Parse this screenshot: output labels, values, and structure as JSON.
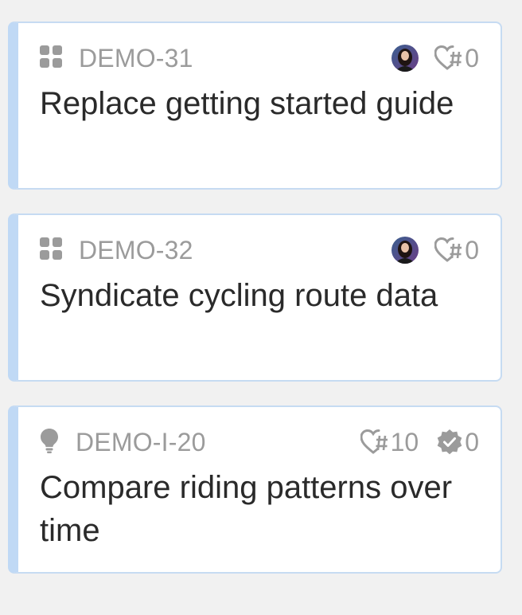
{
  "cards": [
    {
      "type_icon": "feature-grid-icon",
      "ref": "DEMO-31",
      "title": "Replace getting started guide",
      "has_avatar": true,
      "votes": "0"
    },
    {
      "type_icon": "feature-grid-icon",
      "ref": "DEMO-32",
      "title": "Syndicate cycling route data",
      "has_avatar": true,
      "votes": "0"
    },
    {
      "type_icon": "lightbulb-icon",
      "ref": "DEMO-I-20",
      "title": "Compare riding patterns over time",
      "has_avatar": false,
      "votes": "10",
      "approvals": "0"
    }
  ],
  "colors": {
    "card_accent": "#c0d9f5",
    "card_border": "#c6dbf2",
    "meta_text": "#9b9b9b",
    "title_text": "#2a2a2a",
    "background": "#f1f1f1"
  }
}
